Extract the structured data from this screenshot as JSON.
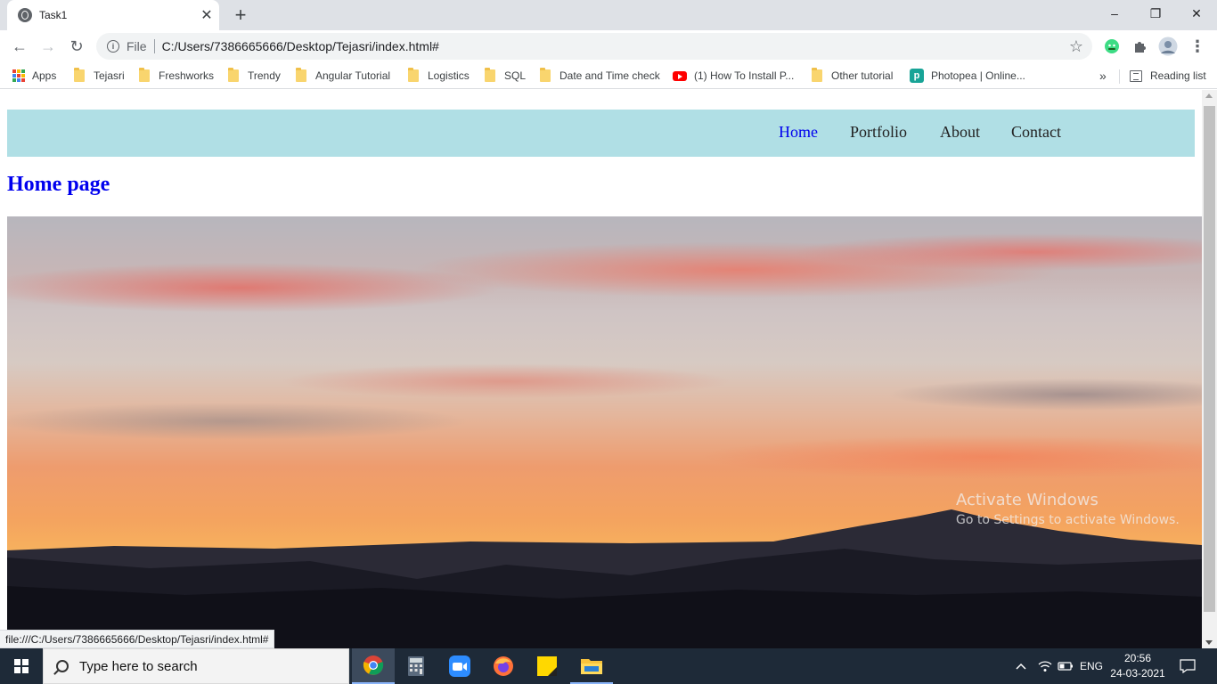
{
  "browser": {
    "tab_title": "Task1",
    "tab_close": "✕",
    "new_tab": "+",
    "window_controls": [
      "–",
      "❐",
      "✕"
    ],
    "nav": {
      "back": "←",
      "forward": "→",
      "reload": "↻"
    },
    "omnibox": {
      "info": "i",
      "scheme": "File",
      "url": "C:/Users/7386665666/Desktop/Tejasri/index.html#",
      "star": "☆"
    },
    "menu": "⋮"
  },
  "bookmarks": {
    "items": [
      {
        "label": "Apps",
        "icon": "apps-grid-icon"
      },
      {
        "label": "Tejasri",
        "icon": "folder-icon"
      },
      {
        "label": "Freshworks",
        "icon": "folder-icon"
      },
      {
        "label": "Trendy",
        "icon": "folder-icon"
      },
      {
        "label": "Angular Tutorial",
        "icon": "folder-icon"
      },
      {
        "label": "Logistics",
        "icon": "folder-icon"
      },
      {
        "label": "SQL",
        "icon": "folder-icon"
      },
      {
        "label": "Date and Time check",
        "icon": "folder-icon"
      },
      {
        "label": "(1) How To Install P...",
        "icon": "youtube-icon"
      },
      {
        "label": "Other tutorial",
        "icon": "folder-icon"
      },
      {
        "label": "Photopea | Online...",
        "icon": "photopea-icon"
      }
    ],
    "overflow": "»",
    "reading_list": "Reading list"
  },
  "page": {
    "nav": [
      {
        "label": "Home",
        "active": true
      },
      {
        "label": "Portfolio",
        "active": false
      },
      {
        "label": "About",
        "active": false
      },
      {
        "label": "Contact",
        "active": false
      }
    ],
    "heading": "Home page",
    "navbar_color": "#b0dfe5",
    "link_color": "#0000ee"
  },
  "watermark": {
    "line1": "Activate Windows",
    "line2": "Go to Settings to activate Windows."
  },
  "status_bar": "file:///C:/Users/7386665666/Desktop/Tejasri/index.html#",
  "taskbar": {
    "search_placeholder": "Type here to search",
    "apps": [
      "chrome-icon",
      "calculator-icon",
      "zoom-icon",
      "firefox-icon",
      "sticky-notes-icon",
      "file-explorer-icon"
    ],
    "tray": {
      "chevron": "^",
      "language": "ENG"
    },
    "time": "20:56",
    "date": "24-03-2021"
  }
}
